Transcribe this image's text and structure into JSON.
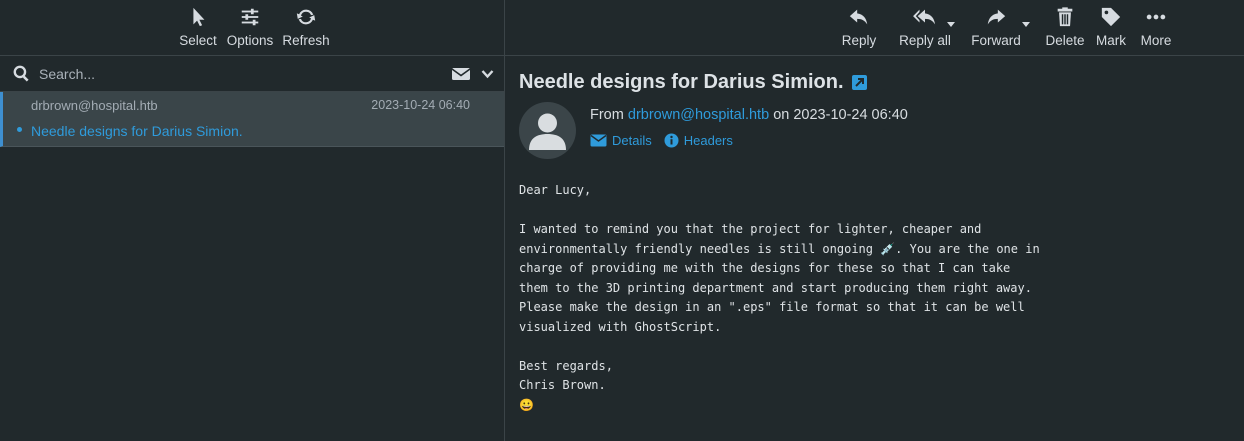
{
  "left_toolbar": {
    "buttons": [
      {
        "label": "Select",
        "icon": "cursor-icon"
      },
      {
        "label": "Options",
        "icon": "sliders-icon"
      },
      {
        "label": "Refresh",
        "icon": "refresh-icon"
      }
    ]
  },
  "right_toolbar": {
    "buttons": [
      {
        "label": "Reply",
        "icon": "reply-icon"
      },
      {
        "label": "Reply all",
        "icon": "reply-all-icon"
      },
      {
        "label": "Forward",
        "icon": "forward-icon"
      },
      {
        "label": "Delete",
        "icon": "trash-icon"
      },
      {
        "label": "Mark",
        "icon": "tag-icon"
      },
      {
        "label": "More",
        "icon": "more-icon"
      }
    ]
  },
  "search": {
    "placeholder": "Search..."
  },
  "message_list": [
    {
      "from": "drbrown@hospital.htb",
      "date": "2023-10-24 06:40",
      "subject": "Needle designs for Darius Simion."
    }
  ],
  "message": {
    "subject": "Needle designs for Darius Simion.",
    "from_prefix": "From",
    "from_address": "drbrown@hospital.htb",
    "on_word": "on",
    "date": "2023-10-24 06:40",
    "details_label": "Details",
    "headers_label": "Headers",
    "body_lines": [
      "Dear Lucy,",
      "",
      "I wanted to remind you that the project for lighter, cheaper and",
      "environmentally friendly needles is still ongoing 💉. You are the one in",
      "charge of providing me with the designs for these so that I can take",
      "them to the 3D printing department and start producing them right away.",
      "Please make the design in an \".eps\" file format so that it can be well",
      "visualized with GhostScript.",
      "",
      "Best regards,",
      "Chris Brown.",
      "😀"
    ]
  },
  "colors": {
    "accent": "#2f9bdb",
    "background": "#21292c",
    "selected_row": "#3a4549"
  }
}
